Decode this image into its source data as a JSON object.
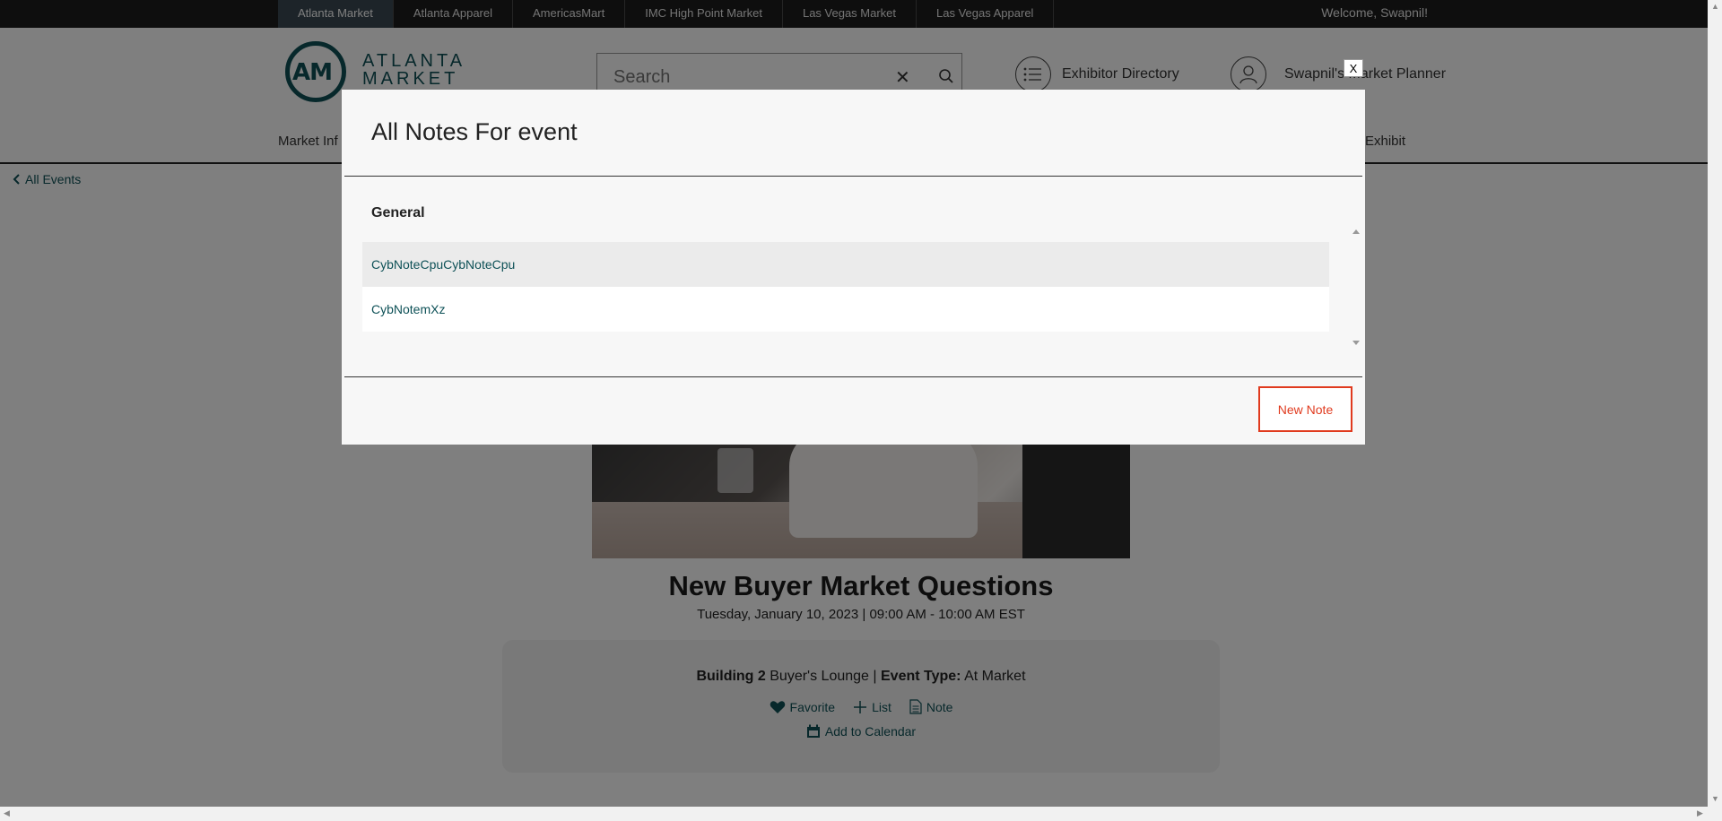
{
  "topbar": {
    "markets": [
      "Atlanta Market",
      "Atlanta Apparel",
      "AmericasMart",
      "IMC High Point Market",
      "Las Vegas Market",
      "Las Vegas Apparel"
    ],
    "welcome": "Welcome, Swapnil!"
  },
  "header": {
    "logo_line1": "ATLANTA",
    "logo_line2": "MARKET",
    "logo_mark": "AM",
    "search_placeholder": "Search",
    "exhibitor_directory": "Exhibitor Directory",
    "market_planner": "Swapnil's Market Planner",
    "nav_left_partial": "Market Inf",
    "nav_right_partial": "Exhibit"
  },
  "back_link": "All Events",
  "event": {
    "title": "New Buyer Market Questions",
    "datetime": "Tuesday, January 10, 2023 | 09:00 AM - 10:00 AM EST",
    "location_bold": "Building 2",
    "location": "Buyer's Lounge",
    "separator": "|",
    "type_label": "Event Type:",
    "type_value": "At Market",
    "actions": {
      "favorite": "Favorite",
      "list": "List",
      "note": "Note",
      "calendar": "Add to Calendar"
    }
  },
  "modal": {
    "title": "All Notes For event",
    "group": "General",
    "notes": [
      "CybNoteCpuCybNoteCpu",
      "CybNotemXz"
    ],
    "new_note_button": "New Note",
    "close": "X"
  },
  "colors": {
    "accent": "#0e5157",
    "danger": "#e03a1e",
    "topbar": "#1d1d1d"
  }
}
